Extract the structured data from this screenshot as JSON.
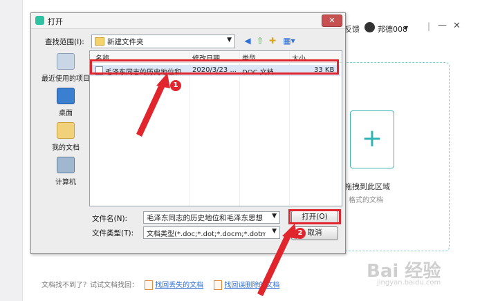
{
  "background_app": {
    "feedback_label": "反馈",
    "user_name": "邦德008",
    "user_dropdown_icon": "chevron-down-icon",
    "minimize_icon": "minimize-icon",
    "close_icon": "close-icon",
    "plus_glyph": "+",
    "drop_text": "拖拽到此区域",
    "drop_sub": "格式的文档",
    "bottom_prompt": "文档找不到了？试试文档找回：",
    "link_recover_lost": "找回丢失的文档",
    "link_recover_deleted": "找回误删除的文档"
  },
  "dialog": {
    "title": "打开",
    "close_glyph": "✕",
    "look_in_label": "查找范围(I):",
    "look_in_value": "新建文件夹",
    "places": [
      {
        "label": "最近使用的项目",
        "icon": "recent-items-icon"
      },
      {
        "label": "桌面",
        "icon": "desktop-icon"
      },
      {
        "label": "我的文档",
        "icon": "my-documents-icon"
      },
      {
        "label": "计算机",
        "icon": "computer-icon"
      }
    ],
    "columns": [
      "名称",
      "修改日期",
      "类型",
      "大小"
    ],
    "files": [
      {
        "name": "毛泽东同志的历史地位和...",
        "date": "2020/3/23 ...",
        "type": "DOC 文档",
        "size": "33 KB"
      }
    ],
    "file_name_label": "文件名(N):",
    "file_name_value": "毛泽东同志的历史地位和毛泽东思想",
    "file_type_label": "文件类型(T):",
    "file_type_value": "文档类型(*.doc;*.dot;*.docm;*.dotm;*.",
    "open_button": "打开(O)",
    "cancel_button": "取消"
  },
  "annotations": {
    "badge1": "1",
    "badge2": "2",
    "accent_color": "#e0262c"
  },
  "watermark": {
    "text": "Bai 经验",
    "sub": "jingyan.baidu.com"
  }
}
